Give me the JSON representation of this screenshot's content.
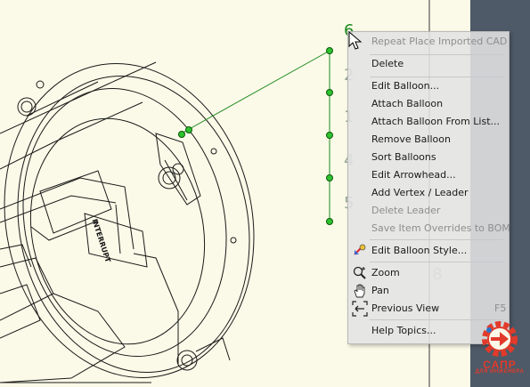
{
  "canvas": {
    "balloons": [
      "6",
      "2",
      "1",
      "4",
      "5"
    ],
    "balloon_behind_menu": "8",
    "part_text": "INTERRUPT"
  },
  "context_menu": {
    "items": [
      {
        "label": "Repeat Place Imported CAD",
        "disabled": true
      },
      {
        "label": "Delete"
      },
      {
        "label": "Edit Balloon..."
      },
      {
        "label": "Attach Balloon"
      },
      {
        "label": "Attach Balloon From List..."
      },
      {
        "label": "Remove Balloon"
      },
      {
        "label": "Sort Balloons"
      },
      {
        "label": "Edit Arrowhead..."
      },
      {
        "label": "Add Vertex / Leader"
      },
      {
        "label": "Delete Leader",
        "disabled": true
      },
      {
        "label": "Save Item Overrides to BOM",
        "disabled": true
      },
      {
        "label": "Edit Balloon Style...",
        "icon": "balloon-style-icon"
      },
      {
        "label": "Zoom",
        "icon": "zoom-icon"
      },
      {
        "label": "Pan",
        "icon": "pan-hand-icon"
      },
      {
        "label": "Previous View",
        "icon": "previous-view-icon",
        "shortcut": "F5"
      },
      {
        "label": "Help Topics..."
      }
    ]
  },
  "watermark": {
    "line1": "САПР",
    "line2": "ДЛЯ ИНЖЕНЕРА",
    "color": "#e23a2a"
  }
}
